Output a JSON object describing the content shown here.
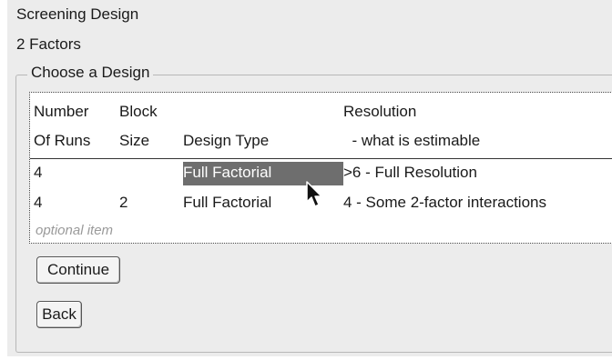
{
  "window": {
    "title": "Screening Design",
    "subtitle": "2 Factors"
  },
  "design_group": {
    "legend": "Choose a Design",
    "columns": [
      {
        "line1": "Number",
        "line2": "Of Runs"
      },
      {
        "line1": "Block",
        "line2": "Size"
      },
      {
        "line1": "",
        "line2": "Design Type"
      },
      {
        "line1": "Resolution",
        "line2": "  - what is estimable"
      }
    ],
    "rows": [
      {
        "runs": "4",
        "block": "",
        "type": "Full Factorial",
        "resolution": ">6 - Full Resolution",
        "selected": true
      },
      {
        "runs": "4",
        "block": "2",
        "type": "Full Factorial",
        "resolution": "4 - Some 2-factor interactions",
        "selected": false
      }
    ],
    "optional_item": "optional item"
  },
  "buttons": {
    "continue": "Continue",
    "back": "Back"
  },
  "colors": {
    "panel_bg": "#ececec",
    "selection_bg": "#6e6e6e"
  }
}
